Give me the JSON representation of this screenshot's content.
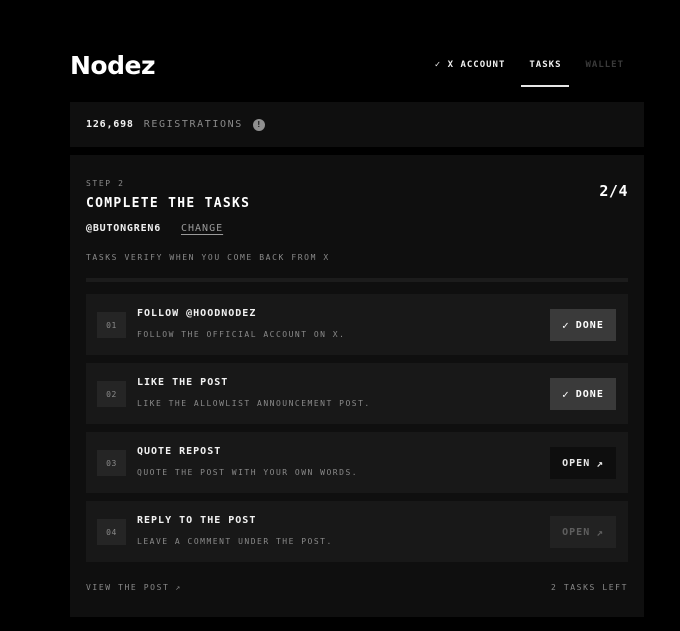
{
  "brand": {
    "logo": "Nodez"
  },
  "nav": {
    "check_icon": "✓",
    "account": "X ACCOUNT",
    "tasks": "TASKS",
    "wallet": "WALLET"
  },
  "registrations": {
    "count": "126,698",
    "label": "REGISTRATIONS",
    "info_icon": "!"
  },
  "card": {
    "step": "STEP 2",
    "title": "COMPLETE THE TASKS",
    "progress": "2/4",
    "handle": "@BUTONGREN6",
    "change": "CHANGE",
    "verify_note": "TASKS VERIFY WHEN YOU COME BACK FROM X"
  },
  "tasks": [
    {
      "num": "01",
      "title": "FOLLOW @HOODNODEZ",
      "desc": "FOLLOW THE OFFICIAL ACCOUNT ON X.",
      "button": "DONE",
      "button_icon": "✓",
      "state": "done"
    },
    {
      "num": "02",
      "title": "LIKE THE POST",
      "desc": "LIKE THE ALLOWLIST ANNOUNCEMENT POST.",
      "button": "DONE",
      "button_icon": "✓",
      "state": "done"
    },
    {
      "num": "03",
      "title": "QUOTE REPOST",
      "desc": "QUOTE THE POST WITH YOUR OWN WORDS.",
      "button": "OPEN",
      "button_icon": "↗",
      "state": "open"
    },
    {
      "num": "04",
      "title": "REPLY TO THE POST",
      "desc": "LEAVE A COMMENT UNDER THE POST.",
      "button": "OPEN",
      "button_icon": "↗",
      "state": "disabled"
    }
  ],
  "footer": {
    "view_post": "VIEW THE POST",
    "view_icon": "↗",
    "tasks_left": "2 TASKS LEFT"
  },
  "colors": {
    "background": "#000000",
    "card": "#0f0f0f",
    "task_row": "#181818",
    "done_button": "#3a3a3a",
    "muted_text": "#8a8a8a"
  }
}
